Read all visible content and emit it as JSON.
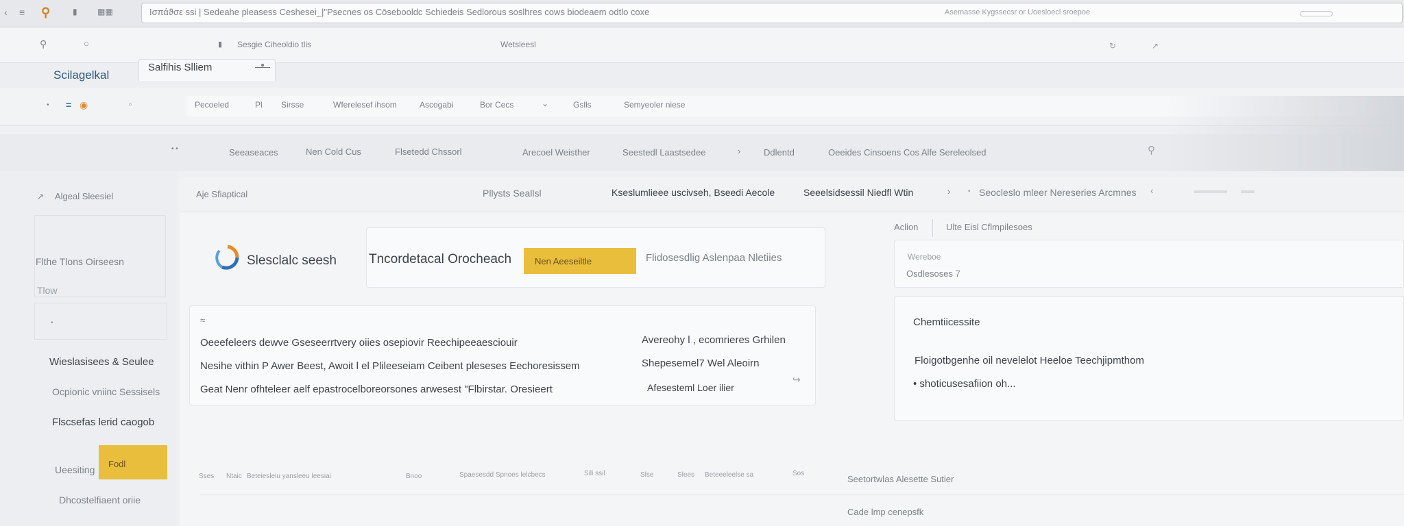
{
  "browser": {
    "url": "Ισπάϑσε ssi | Sedeahe pleasess  Ceshesei_|\"Psecnes os Cōsebooldc Schiedeis Sedlorous soslhres cows biodeaem odtlo coxe",
    "url_right": "Asemasse  Kygssecsr or Uoesloecl sroepoe",
    "toolbar_center_label": "Sesgie Ciheoldio tlis",
    "toolbar_mid_label": "Wetsleesl"
  },
  "tab": {
    "label": "Salfihis Slliem"
  },
  "brand": {
    "logo_text": "Scilagelkal"
  },
  "menubar": {
    "items": [
      "Pecoeled",
      "Pl",
      "Sirsse",
      "Wferelesef ihsom",
      "Ascogabi",
      "Bor Cecs",
      "Gslls",
      "Semyeoler niese"
    ]
  },
  "navbar": {
    "items": [
      "Seeaseaces",
      "Nen Cold Cus",
      "Flsetedd Chssorl",
      "Arecoel Weisther",
      "Seestedl Laastsedee",
      "Ddlentd",
      "Oeeides Cinsoens Cos Alfe Sereleolsed"
    ]
  },
  "subnav": {
    "left": "Aje Sfiaptical",
    "center": "Pllysts Seallsl",
    "items": [
      "Kseslumlieee uscivseh, Bseedi Aecole",
      "Seeelsidsessil Niedfl Wtin",
      "Seocleslo mleer Nereseries Arcmnes"
    ]
  },
  "sidebar": {
    "header": "Algeal Sleesiel",
    "title_line1": "Flthe Tlons Oirseesn",
    "title_line2": "Tlow",
    "items": [
      "Wieslasisees & Seulee",
      "Ocpionic vniinc Sessisels",
      "Flscsefas lerid caogob"
    ],
    "button_left": "Ueesiting",
    "button_label": "Fodl",
    "footer": "Dhcostelfiaent oriie"
  },
  "hero": {
    "brand_text": "Slesclalc seesh",
    "title": "Tncordetacal Orocheach",
    "cta": "Nen Aeeseiltle",
    "cta_side": "Flidosesdlig Aslenpaa Nletiies"
  },
  "actionbar": {
    "action_label": "Aclion",
    "link": "Ulte Eisl Cflmpilesoes"
  },
  "info_card": {
    "line1": "Wereboe",
    "line2": "Osdlesoses 7"
  },
  "content": {
    "marker": "≈",
    "lines": [
      "Oeeefeleers dewve Gseseerrtvery oiies osepiovir Reechipeeaesciouir",
      "Nesihe vithin P Awer Beest, Awoit l el Plileeseiam Ceibent pleseses Eechoresissem",
      "Geat Nenr ofhteleer aelf epastrocelboreorsones arwesest  \"Flbirstar. Oresieert"
    ],
    "right_lines": [
      "Avereohy l , ecomrieres Grhilen",
      "Shepesemel7 Wel Aleoirn",
      "Afesesteml Loer ilier"
    ]
  },
  "right_panel": {
    "title": "Chemtiicessite",
    "body1": "Floigotbgenhe oil nevelelot Heeloe Teechjipmthom",
    "body2": "• shoticusesafiion oh..."
  },
  "bottom": {
    "row_items": [
      "Sses",
      "Ntaic",
      "Beteiesleiu yansleeu leesiai",
      "Bnoo",
      "Spaesesdd Spnoes lelcbecs",
      "Sili ssil",
      "Slse",
      "Slees",
      "Beteeeleelse sa",
      "Sos"
    ],
    "right_caption1": "Seetortwlas Alesette Sutier",
    "right_caption2": "Cade lmp cenepsfk"
  }
}
